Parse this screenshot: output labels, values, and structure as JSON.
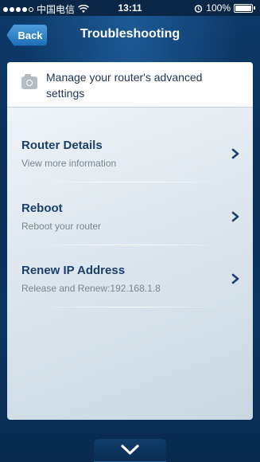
{
  "status_bar": {
    "carrier": "中国电信",
    "time": "13:11",
    "battery": "100%"
  },
  "nav": {
    "back_label": "Back",
    "title": "Troubleshooting"
  },
  "header": {
    "text": "Manage your router's advanced settings",
    "icon": "camera-icon"
  },
  "items": [
    {
      "title": "Router Details",
      "subtitle": "View more information"
    },
    {
      "title": "Reboot",
      "subtitle": "Reboot your router"
    },
    {
      "title": "Renew IP Address",
      "subtitle": "Release and Renew:192.168.1.8"
    }
  ],
  "colors": {
    "accent": "#1a3f6b",
    "nav_button": "#2b7fc6"
  }
}
